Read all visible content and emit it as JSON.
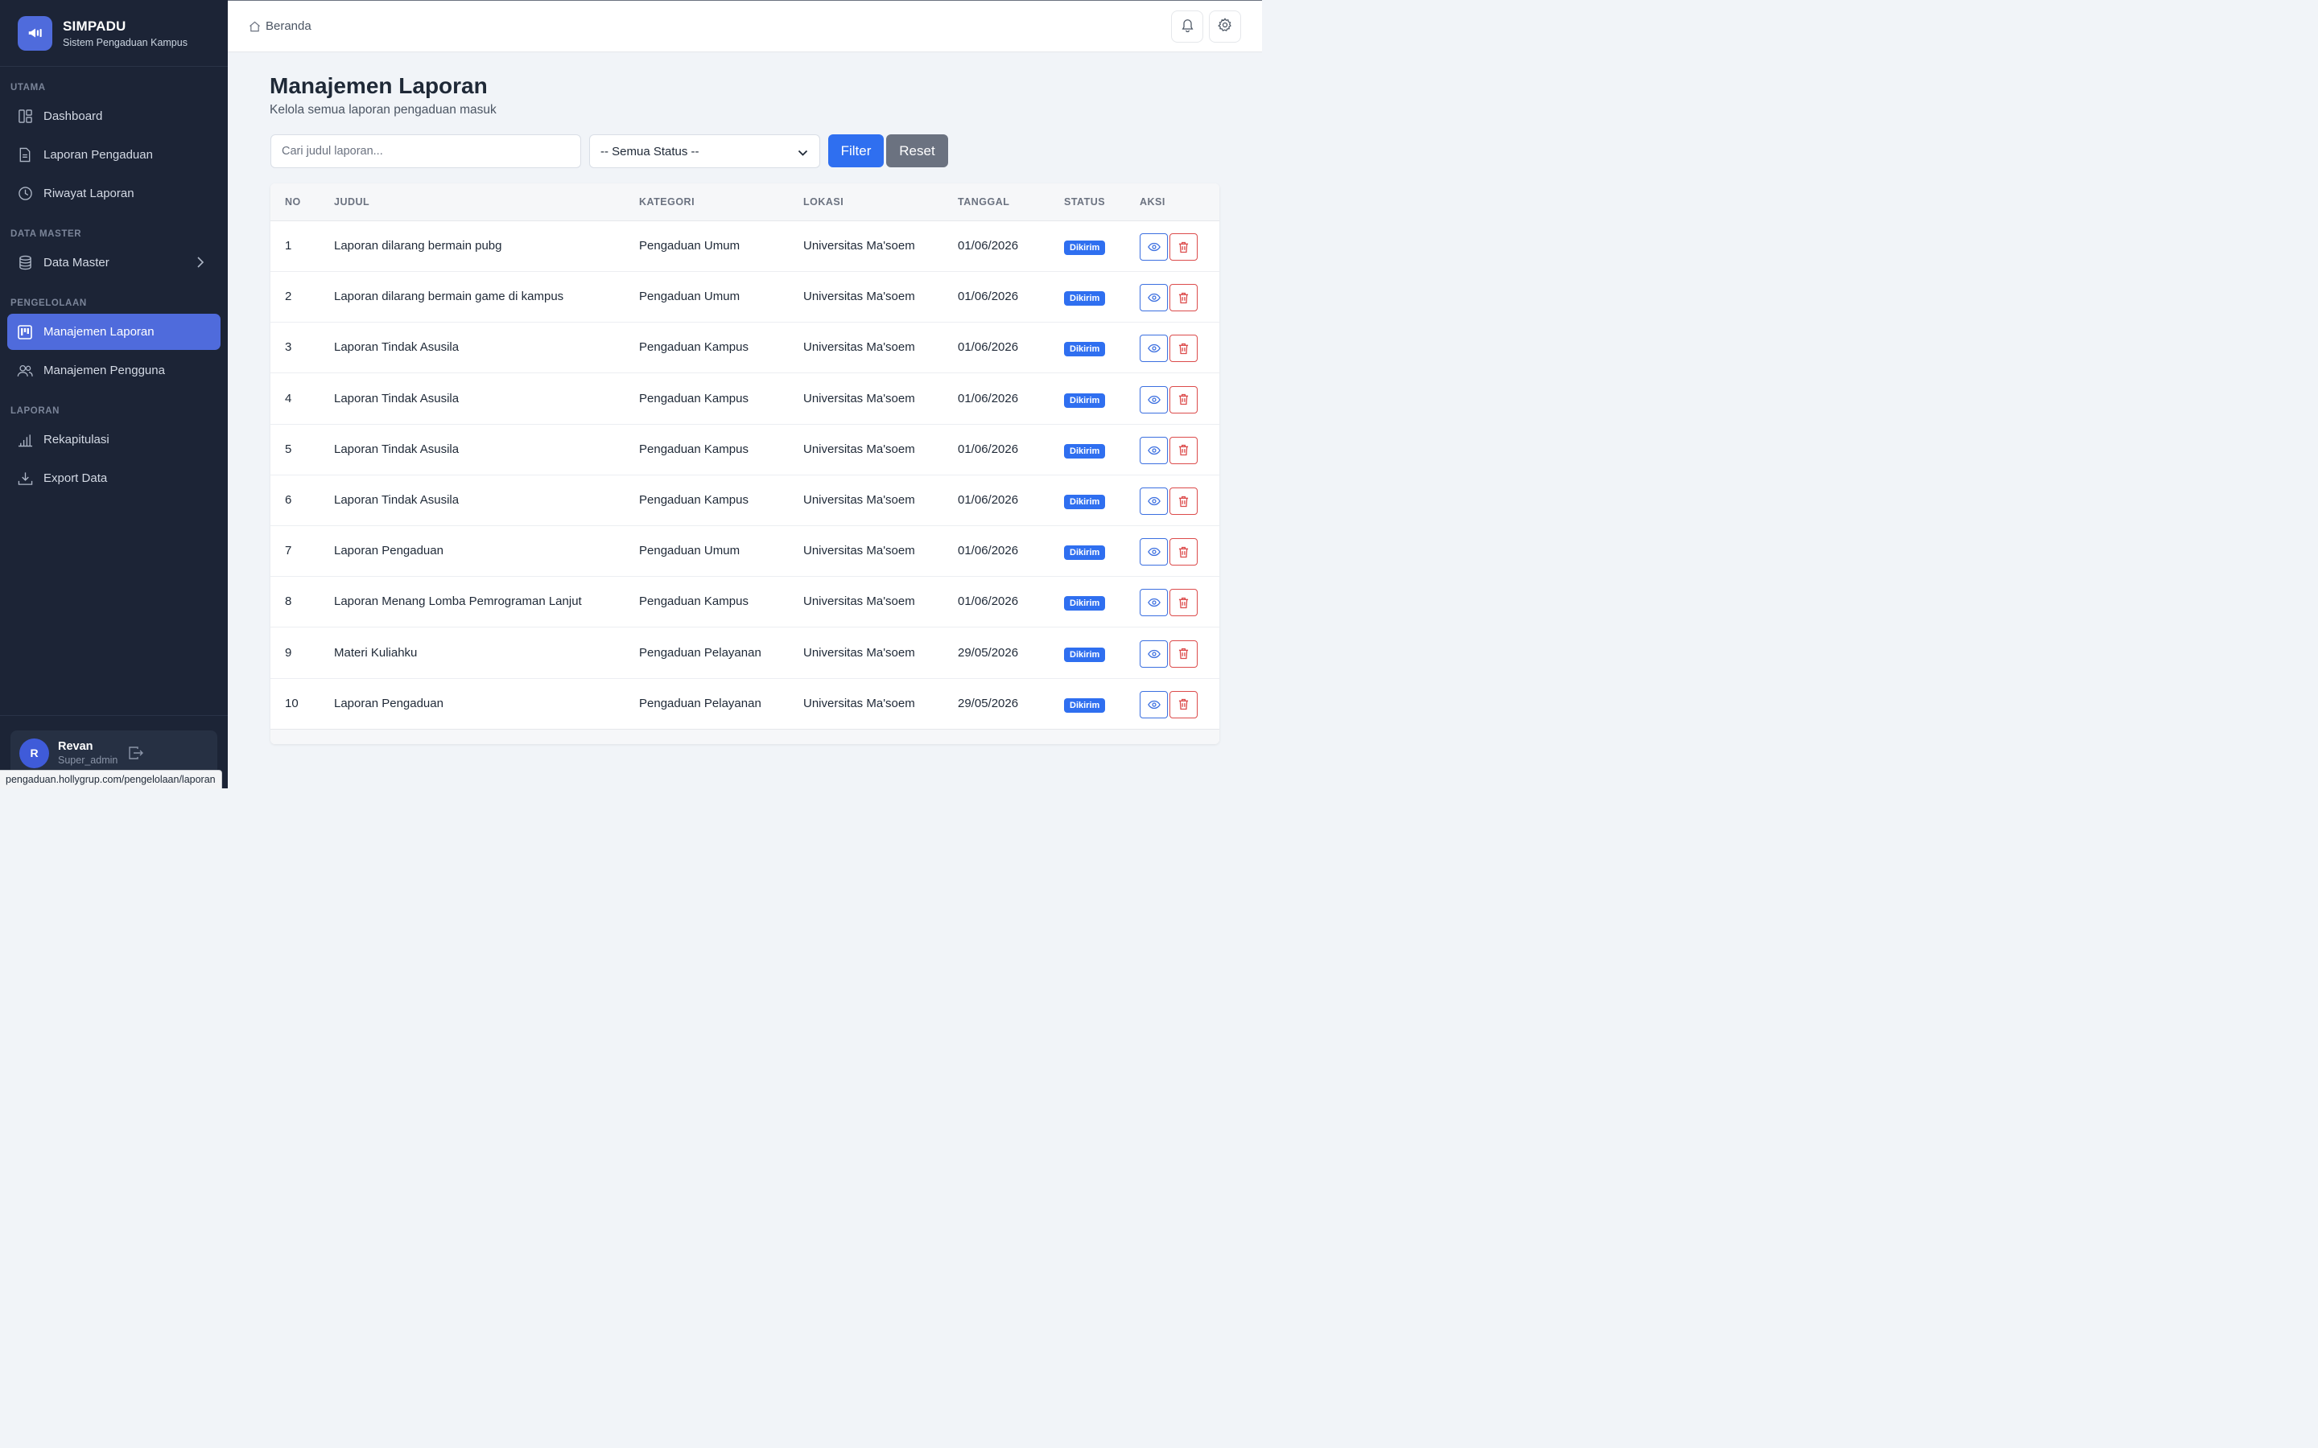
{
  "brand": {
    "title": "SIMPADU",
    "subtitle": "Sistem Pengaduan Kampus"
  },
  "sidebar": {
    "sections": [
      "UTAMA",
      "DATA MASTER",
      "PENGELOLAAN",
      "LAPORAN"
    ],
    "items": [
      {
        "label": "Dashboard",
        "icon": "dashboard-icon"
      },
      {
        "label": "Laporan Pengaduan",
        "icon": "document-icon"
      },
      {
        "label": "Riwayat Laporan",
        "icon": "clock-icon"
      },
      {
        "label": "Data Master",
        "icon": "database-icon"
      },
      {
        "label": "Manajemen Laporan",
        "icon": "kanban-icon",
        "active": true
      },
      {
        "label": "Manajemen Pengguna",
        "icon": "users-icon"
      },
      {
        "label": "Rekapitulasi",
        "icon": "bar-chart-icon"
      },
      {
        "label": "Export Data",
        "icon": "download-icon"
      }
    ],
    "user": {
      "initial": "R",
      "name": "Revan",
      "role": "Super_admin"
    }
  },
  "topbar": {
    "breadcrumb": "Beranda"
  },
  "page": {
    "title": "Manajemen Laporan",
    "subtitle": "Kelola semua laporan pengaduan masuk"
  },
  "filters": {
    "search_placeholder": "Cari judul laporan...",
    "status_value": "-- Semua Status --",
    "filter_label": "Filter",
    "reset_label": "Reset"
  },
  "table": {
    "headers": [
      "NO",
      "JUDUL",
      "KATEGORI",
      "LOKASI",
      "TANGGAL",
      "STATUS",
      "AKSI"
    ],
    "rows": [
      {
        "no": "1",
        "judul": "Laporan dilarang bermain pubg",
        "kategori": "Pengaduan Umum",
        "lokasi": "Universitas Ma'soem",
        "tanggal": "01/06/2026",
        "status": "Dikirim"
      },
      {
        "no": "2",
        "judul": "Laporan dilarang bermain game di kampus",
        "kategori": "Pengaduan Umum",
        "lokasi": "Universitas Ma'soem",
        "tanggal": "01/06/2026",
        "status": "Dikirim"
      },
      {
        "no": "3",
        "judul": "Laporan Tindak Asusila",
        "kategori": "Pengaduan Kampus",
        "lokasi": "Universitas Ma'soem",
        "tanggal": "01/06/2026",
        "status": "Dikirim"
      },
      {
        "no": "4",
        "judul": "Laporan Tindak Asusila",
        "kategori": "Pengaduan Kampus",
        "lokasi": "Universitas Ma'soem",
        "tanggal": "01/06/2026",
        "status": "Dikirim"
      },
      {
        "no": "5",
        "judul": "Laporan Tindak Asusila",
        "kategori": "Pengaduan Kampus",
        "lokasi": "Universitas Ma'soem",
        "tanggal": "01/06/2026",
        "status": "Dikirim"
      },
      {
        "no": "6",
        "judul": "Laporan Tindak Asusila",
        "kategori": "Pengaduan Kampus",
        "lokasi": "Universitas Ma'soem",
        "tanggal": "01/06/2026",
        "status": "Dikirim"
      },
      {
        "no": "7",
        "judul": "Laporan Pengaduan",
        "kategori": "Pengaduan Umum",
        "lokasi": "Universitas Ma'soem",
        "tanggal": "01/06/2026",
        "status": "Dikirim"
      },
      {
        "no": "8",
        "judul": "Laporan Menang Lomba Pemrograman Lanjut",
        "kategori": "Pengaduan Kampus",
        "lokasi": "Universitas Ma'soem",
        "tanggal": "01/06/2026",
        "status": "Dikirim"
      },
      {
        "no": "9",
        "judul": "Materi Kuliahku",
        "kategori": "Pengaduan Pelayanan",
        "lokasi": "Universitas Ma'soem",
        "tanggal": "29/05/2026",
        "status": "Dikirim"
      },
      {
        "no": "10",
        "judul": "Laporan Pengaduan",
        "kategori": "Pengaduan Pelayanan",
        "lokasi": "Universitas Ma'soem",
        "tanggal": "29/05/2026",
        "status": "Dikirim"
      }
    ]
  },
  "status_bar_url": "pengaduan.hollygrup.com/pengelolaan/laporan",
  "colors": {
    "sidebar_bg": "#1c2436",
    "accent": "#4f6bdc",
    "primary_button": "#2f6ff0",
    "reset_button": "#6b7280",
    "danger": "#dc4b4b"
  }
}
